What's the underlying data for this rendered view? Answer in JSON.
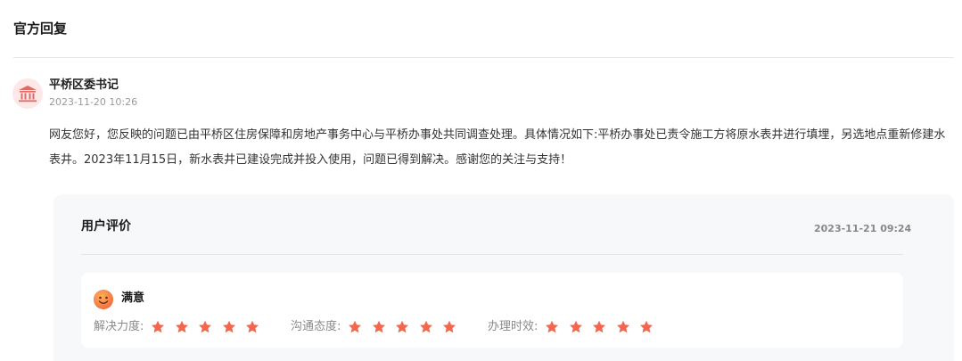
{
  "section": {
    "title": "官方回复"
  },
  "reply": {
    "author": "平桥区委书记",
    "time": "2023-11-20 10:26",
    "body": "网友您好，您反映的问题已由平桥区住房保障和房地产事务中心与平桥办事处共同调查处理。具体情况如下:平桥办事处已责令施工方将原水表井进行填埋，另选地点重新修建水表井。2023年11月15日，新水表井已建设完成并投入使用，问题已得到解决。感谢您的关注与支持！",
    "avatar_icon": "government-building-icon"
  },
  "evaluation": {
    "title": "用户评价",
    "time": "2023-11-21 09:24",
    "satisfaction": "满意",
    "face_icon": "smiley-face-icon",
    "star_color": "#f2684f",
    "ratings": [
      {
        "label": "解决力度:",
        "stars": 5
      },
      {
        "label": "沟通态度:",
        "stars": 5
      },
      {
        "label": "办理时效:",
        "stars": 5
      }
    ]
  }
}
